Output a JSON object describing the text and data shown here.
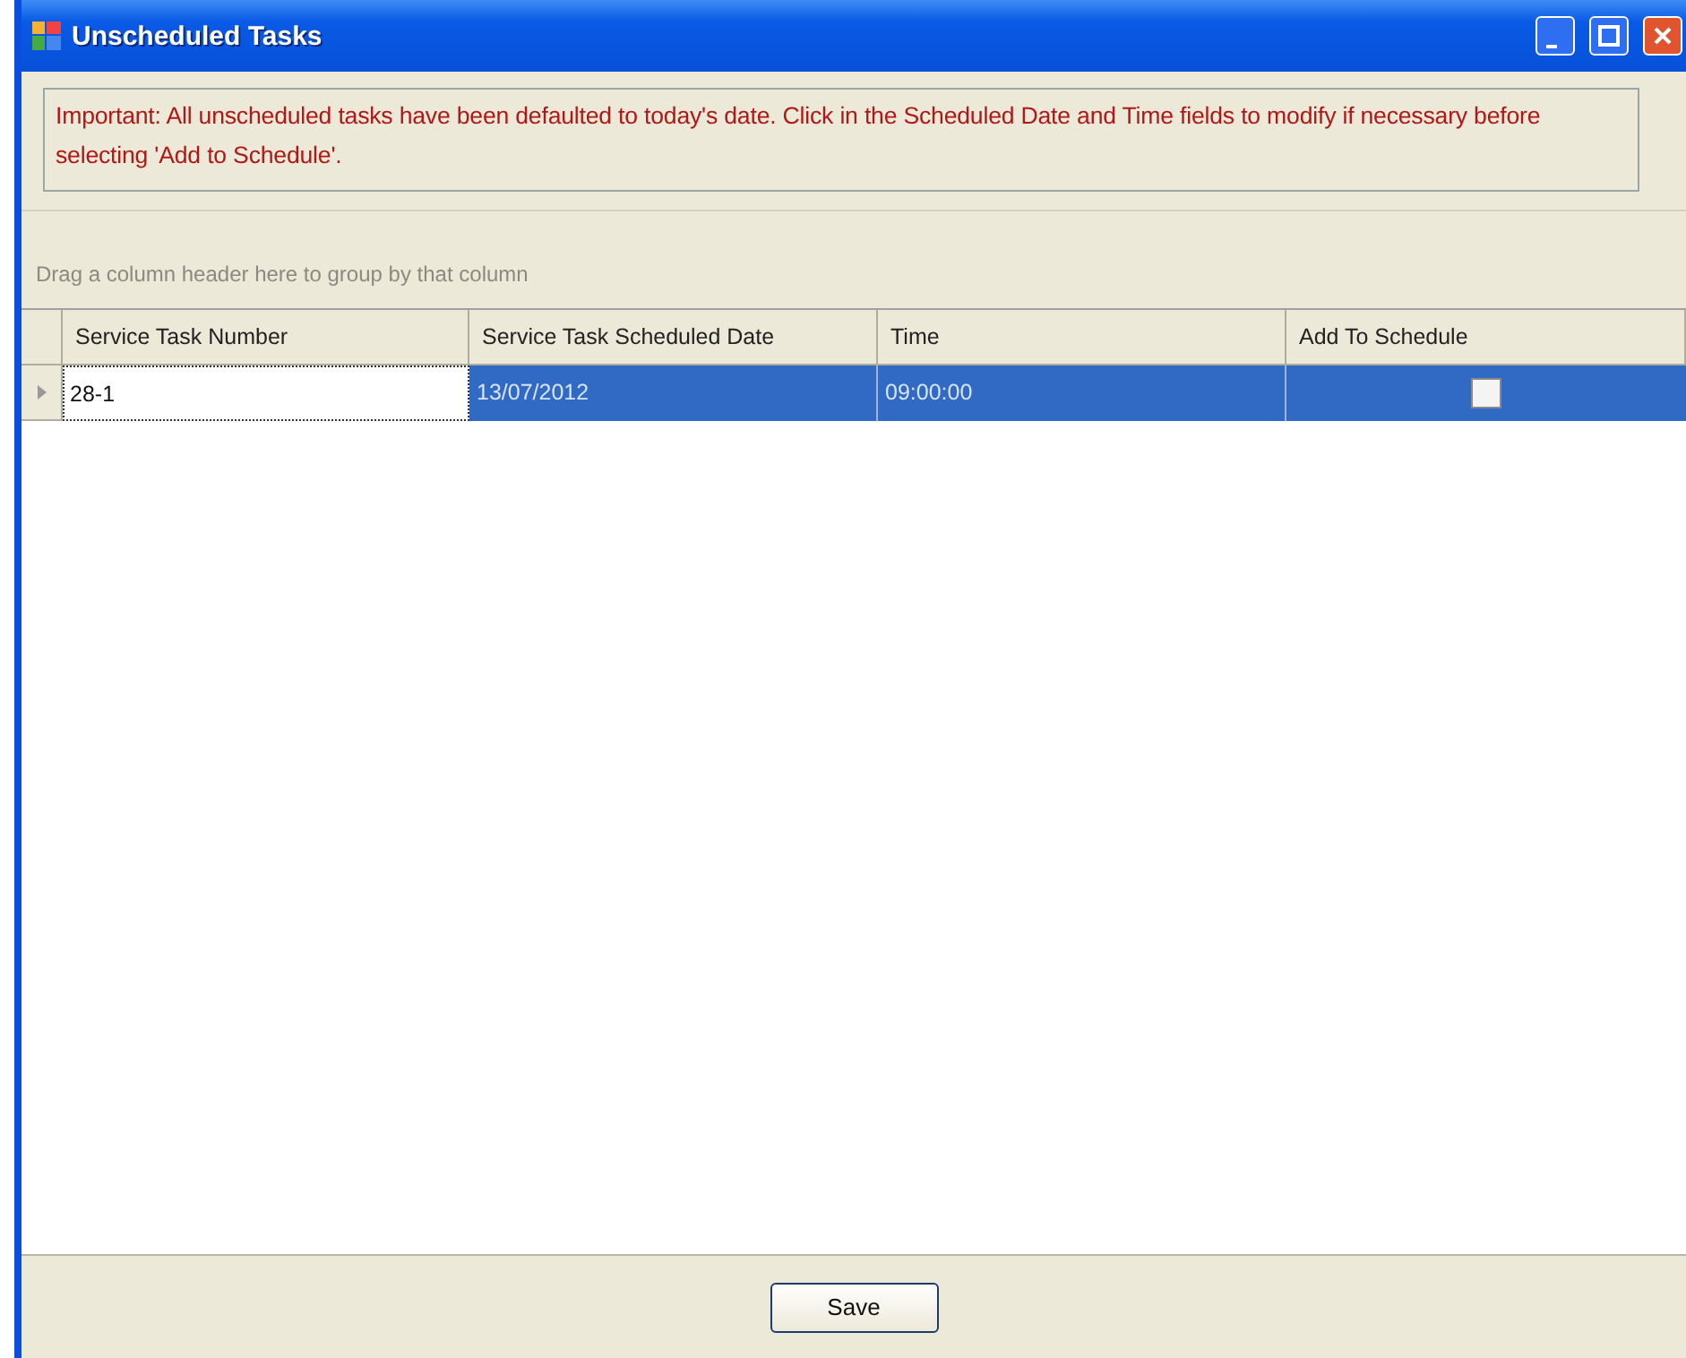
{
  "window": {
    "title": "Unscheduled Tasks"
  },
  "notice": "Important: All unscheduled tasks have been defaulted to today's date. Click in the Scheduled Date and Time fields to modify if necessary before selecting 'Add to Schedule'.",
  "group_hint": "Drag a column header here to group by that column",
  "table": {
    "columns": [
      "Service Task Number",
      "Service Task Scheduled Date",
      "Time",
      "Add To Schedule"
    ],
    "rows": [
      {
        "number": "28-1",
        "date": "13/07/2012",
        "time": "09:00:00",
        "add_to_schedule": false,
        "selected": true
      }
    ]
  },
  "buttons": [
    "Save"
  ]
}
